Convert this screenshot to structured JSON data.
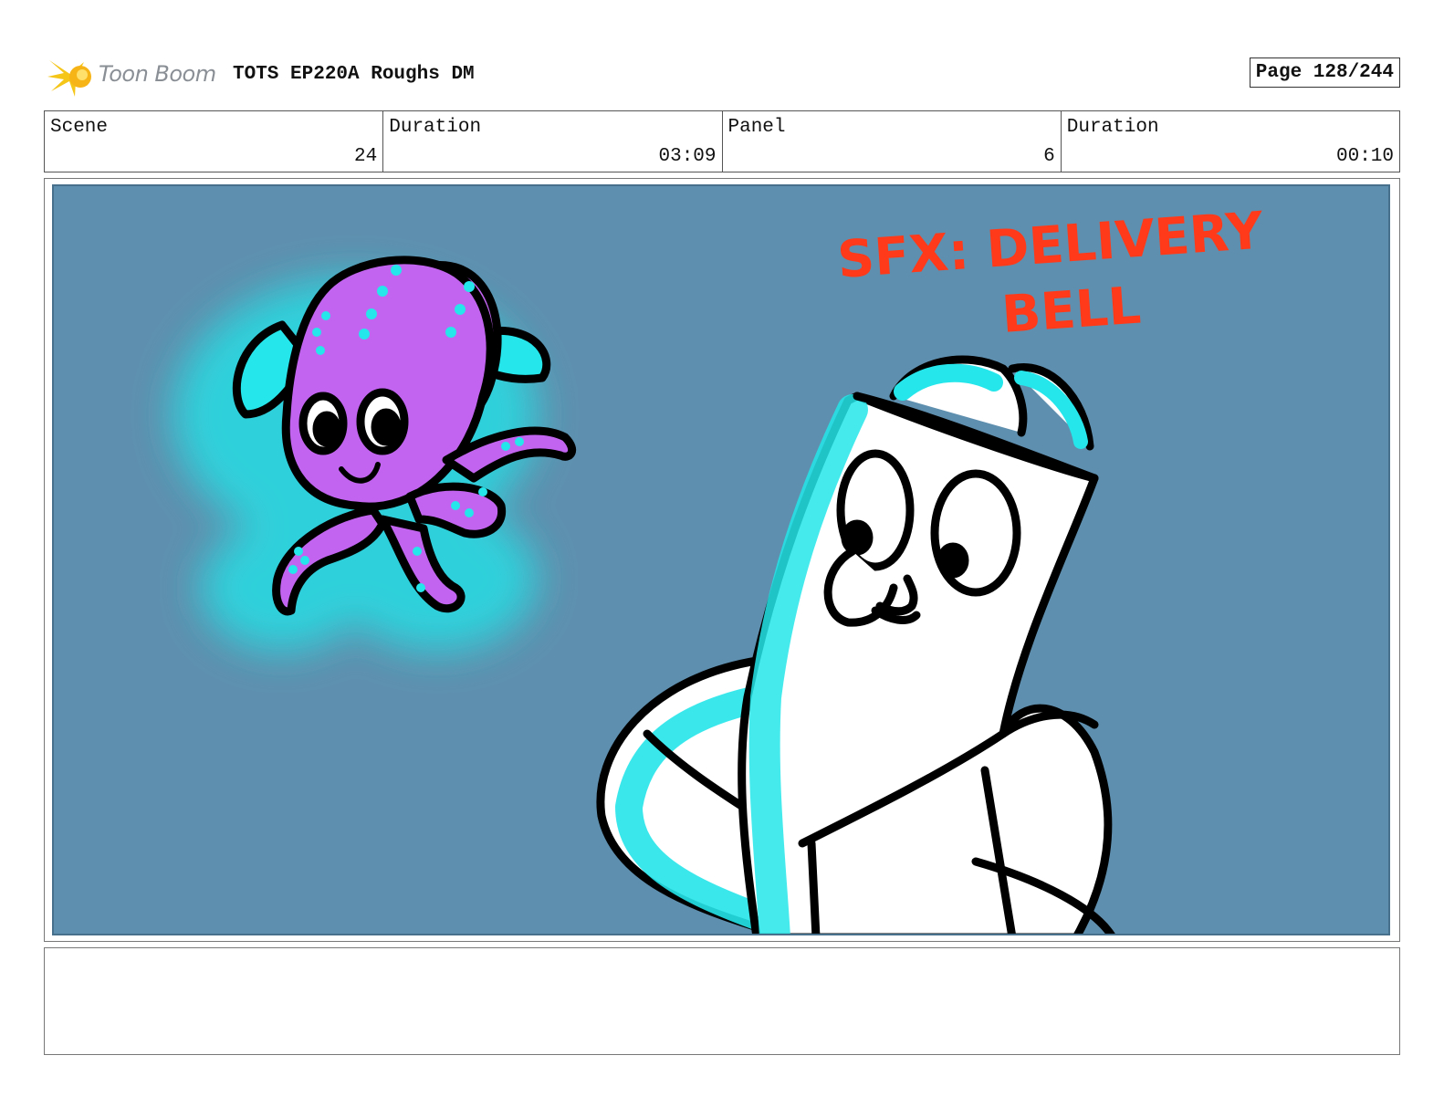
{
  "header": {
    "logo_text": "Toon Boom",
    "title": "TOTS EP220A Roughs DM",
    "page_label": "Page 128/244"
  },
  "info": {
    "scene": {
      "label": "Scene",
      "value": "24"
    },
    "scene_duration": {
      "label": "Duration",
      "value": "03:09"
    },
    "panel": {
      "label": "Panel",
      "value": "6"
    },
    "panel_duration": {
      "label": "Duration",
      "value": "00:10"
    }
  },
  "panel_art": {
    "sfx_line1": "SFX: DELIVERY",
    "sfx_line2": "BELL",
    "background_color": "#5f8fae",
    "octopus_color": "#c264f0",
    "glow_color": "#28dde3",
    "sfx_color": "#ff3a1a"
  },
  "notes": {
    "text": ""
  }
}
